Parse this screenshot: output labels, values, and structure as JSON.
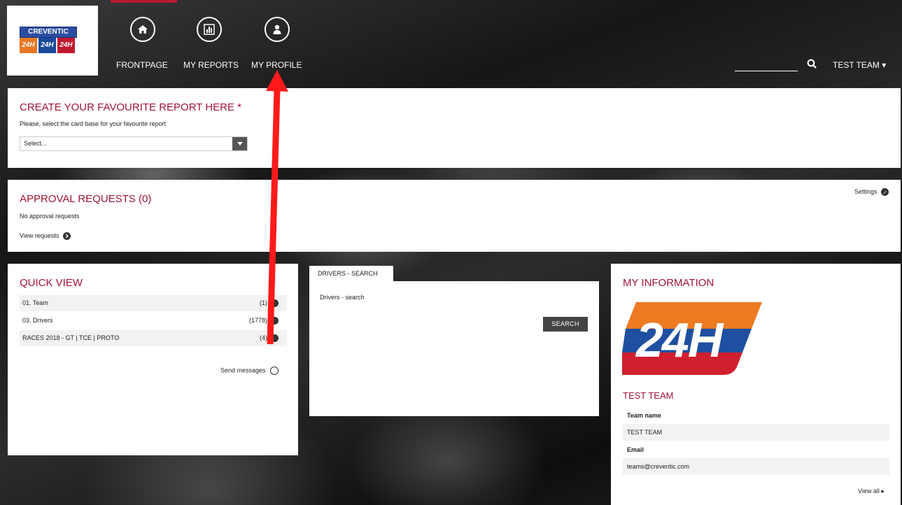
{
  "brand": {
    "logo_title": "CREVENTIC",
    "logo_tiles": [
      "24H",
      "24H",
      "24H"
    ],
    "tile_colors": [
      "#e87722",
      "#1a4a9c",
      "#c0182e"
    ]
  },
  "nav": {
    "items": [
      {
        "label": "FRONTPAGE",
        "icon": "home-icon"
      },
      {
        "label": "MY REPORTS",
        "icon": "bar-chart-icon"
      },
      {
        "label": "MY PROFILE",
        "icon": "user-icon"
      }
    ]
  },
  "header": {
    "search_placeholder": "",
    "user_label": "TEST TEAM ▾"
  },
  "favourite": {
    "title": "CREATE YOUR FAVOURITE REPORT HERE *",
    "hint": "Please, select the card base for your favourite report",
    "select_value": "Select..."
  },
  "approval": {
    "title": "APPROVAL REQUESTS (0)",
    "settings_label": "Settings",
    "empty_text": "No approval requests",
    "view_label": "View requests"
  },
  "quick_view": {
    "title": "QUICK VIEW",
    "rows": [
      {
        "label": "01. Team",
        "count": "(1)"
      },
      {
        "label": "03. Drivers",
        "count": "(1778)"
      },
      {
        "label": "RACES 2018 - GT | TCE | PROTO",
        "count": "(4)"
      }
    ],
    "send_label": "Send messages"
  },
  "drivers_search": {
    "tab_label": "DRIVERS - SEARCH",
    "body_label": "Drivers - search",
    "button_label": "SEARCH"
  },
  "my_info": {
    "title": "MY INFORMATION",
    "logo_text": "24H",
    "team_title": "TEST TEAM",
    "team_name_label": "Team name",
    "team_name_value": "TEST TEAM",
    "email_label": "Email",
    "email_value": "teams@creventic.com",
    "view_all_label": "View all"
  },
  "colors": {
    "accent": "#a01534",
    "annotation_arrow": "#ff0000"
  }
}
